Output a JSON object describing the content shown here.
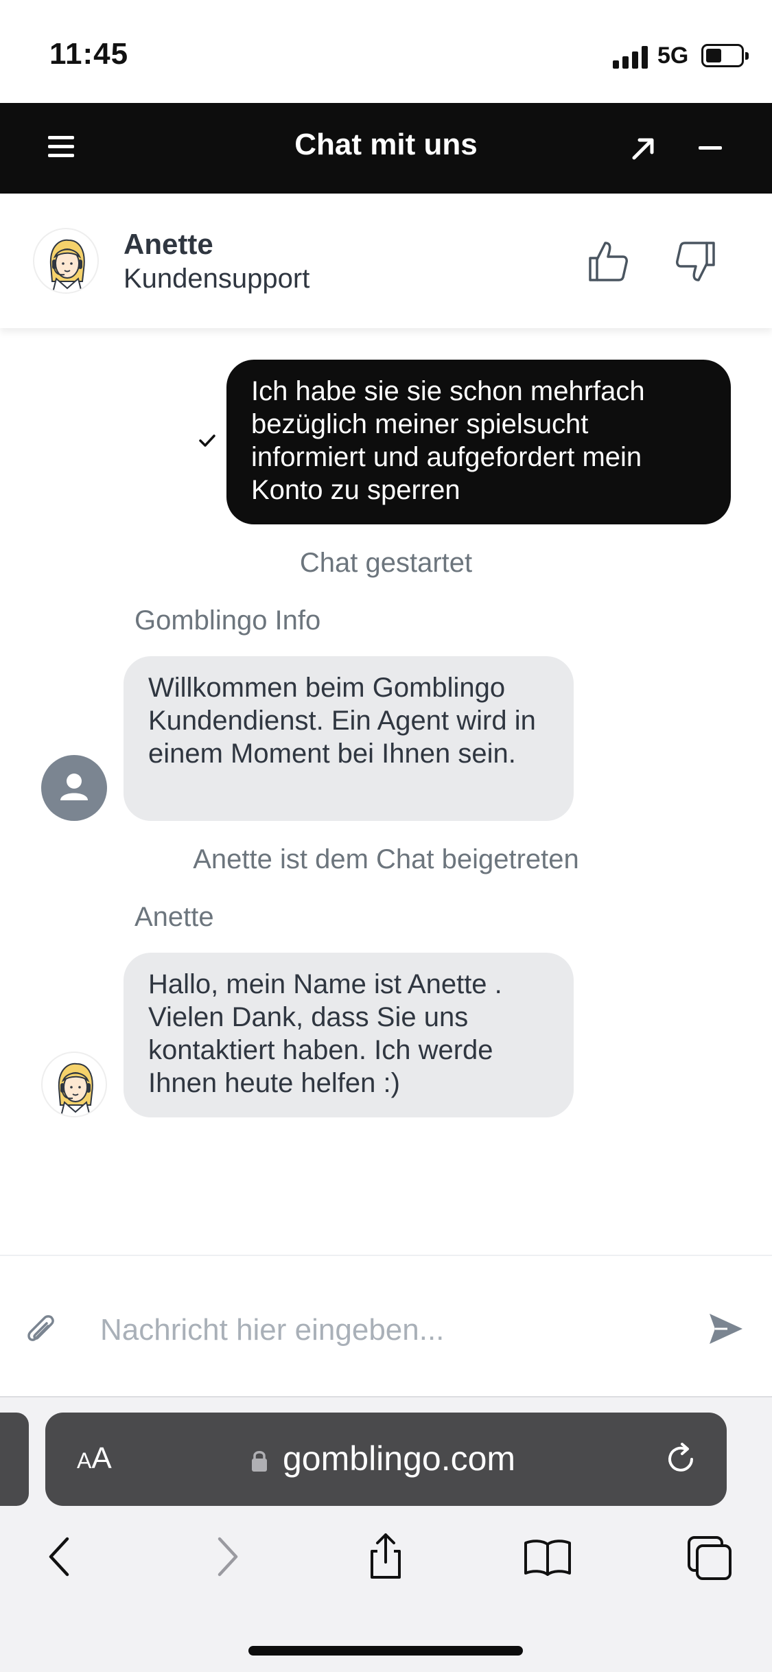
{
  "status_bar": {
    "time": "11:45",
    "network": "5G"
  },
  "chat_header": {
    "title": "Chat mit uns",
    "menu_icon": "hamburger-icon",
    "expand_icon": "arrow-up-right-icon",
    "minimize_icon": "minus-icon"
  },
  "agent": {
    "name": "Anette",
    "role": "Kundensupport",
    "avatar_icon": "support-agent-headset-avatar",
    "rating_icons": [
      "thumbs-up-icon",
      "thumbs-down-icon"
    ]
  },
  "messages": {
    "outgoing": {
      "text": "Ich habe sie sie schon mehrfach bezüglich meiner spielsucht informiert und aufgefordert mein Konto zu sperren",
      "status_icon": "checkmark-icon"
    },
    "chat_started": "Chat gestartet",
    "bot_sender": "Gomblingo Info",
    "bot_text": "Willkommen beim Gomblingo Kundendienst. Ein Agent wird in einem Moment bei Ihnen sein.",
    "agent_joined": "Anette ist dem Chat beigetreten",
    "agent_sender": "Anette",
    "agent_text": "Hallo, mein Name ist Anette . Vielen Dank, dass Sie uns kontaktiert haben. Ich werde Ihnen heute helfen :)"
  },
  "composer": {
    "placeholder": "Nachricht hier eingeben...",
    "attach_icon": "paperclip-icon",
    "send_icon": "send-icon"
  },
  "browser": {
    "aa_small": "A",
    "aa_large": "A",
    "url": "gomblingo.com",
    "colors": {
      "address_bar": "#4a4a4c",
      "header": "#0d0d0d",
      "bubble_in": "#e9eaec"
    }
  }
}
